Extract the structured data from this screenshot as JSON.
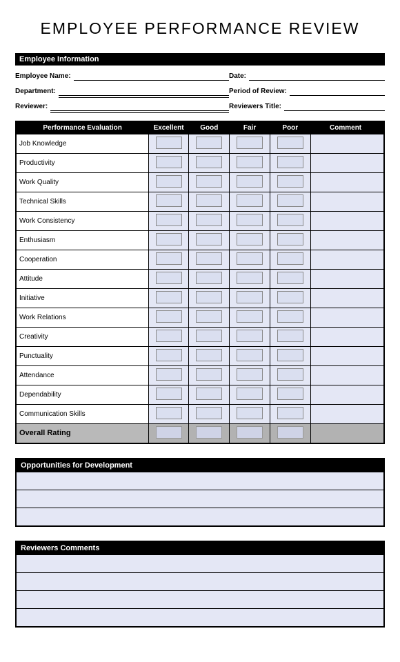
{
  "title": "EMPLOYEE PERFORMANCE REVIEW",
  "sections": {
    "employee_info": "Employee Information",
    "evaluation": "Performance Evaluation",
    "opportunities": "Opportunities for Development",
    "comments": "Reviewers Comments"
  },
  "info_fields": {
    "name": "Employee Name:",
    "department": "Department:",
    "reviewer": "Reviewer:",
    "date": "Date:",
    "period": "Period of Review:",
    "rev_title": "Reviewers Title:"
  },
  "rating_headers": {
    "excellent": "Excellent",
    "good": "Good",
    "fair": "Fair",
    "poor": "Poor",
    "comment": "Comment"
  },
  "criteria": [
    "Job Knowledge",
    "Productivity",
    "Work Quality",
    "Technical Skills",
    "Work Consistency",
    "Enthusiasm",
    "Cooperation",
    "Attitude",
    "Initiative",
    "Work Relations",
    "Creativity",
    "Punctuality",
    "Attendance",
    "Dependability",
    "Communication Skills"
  ],
  "overall_label": "Overall Rating"
}
